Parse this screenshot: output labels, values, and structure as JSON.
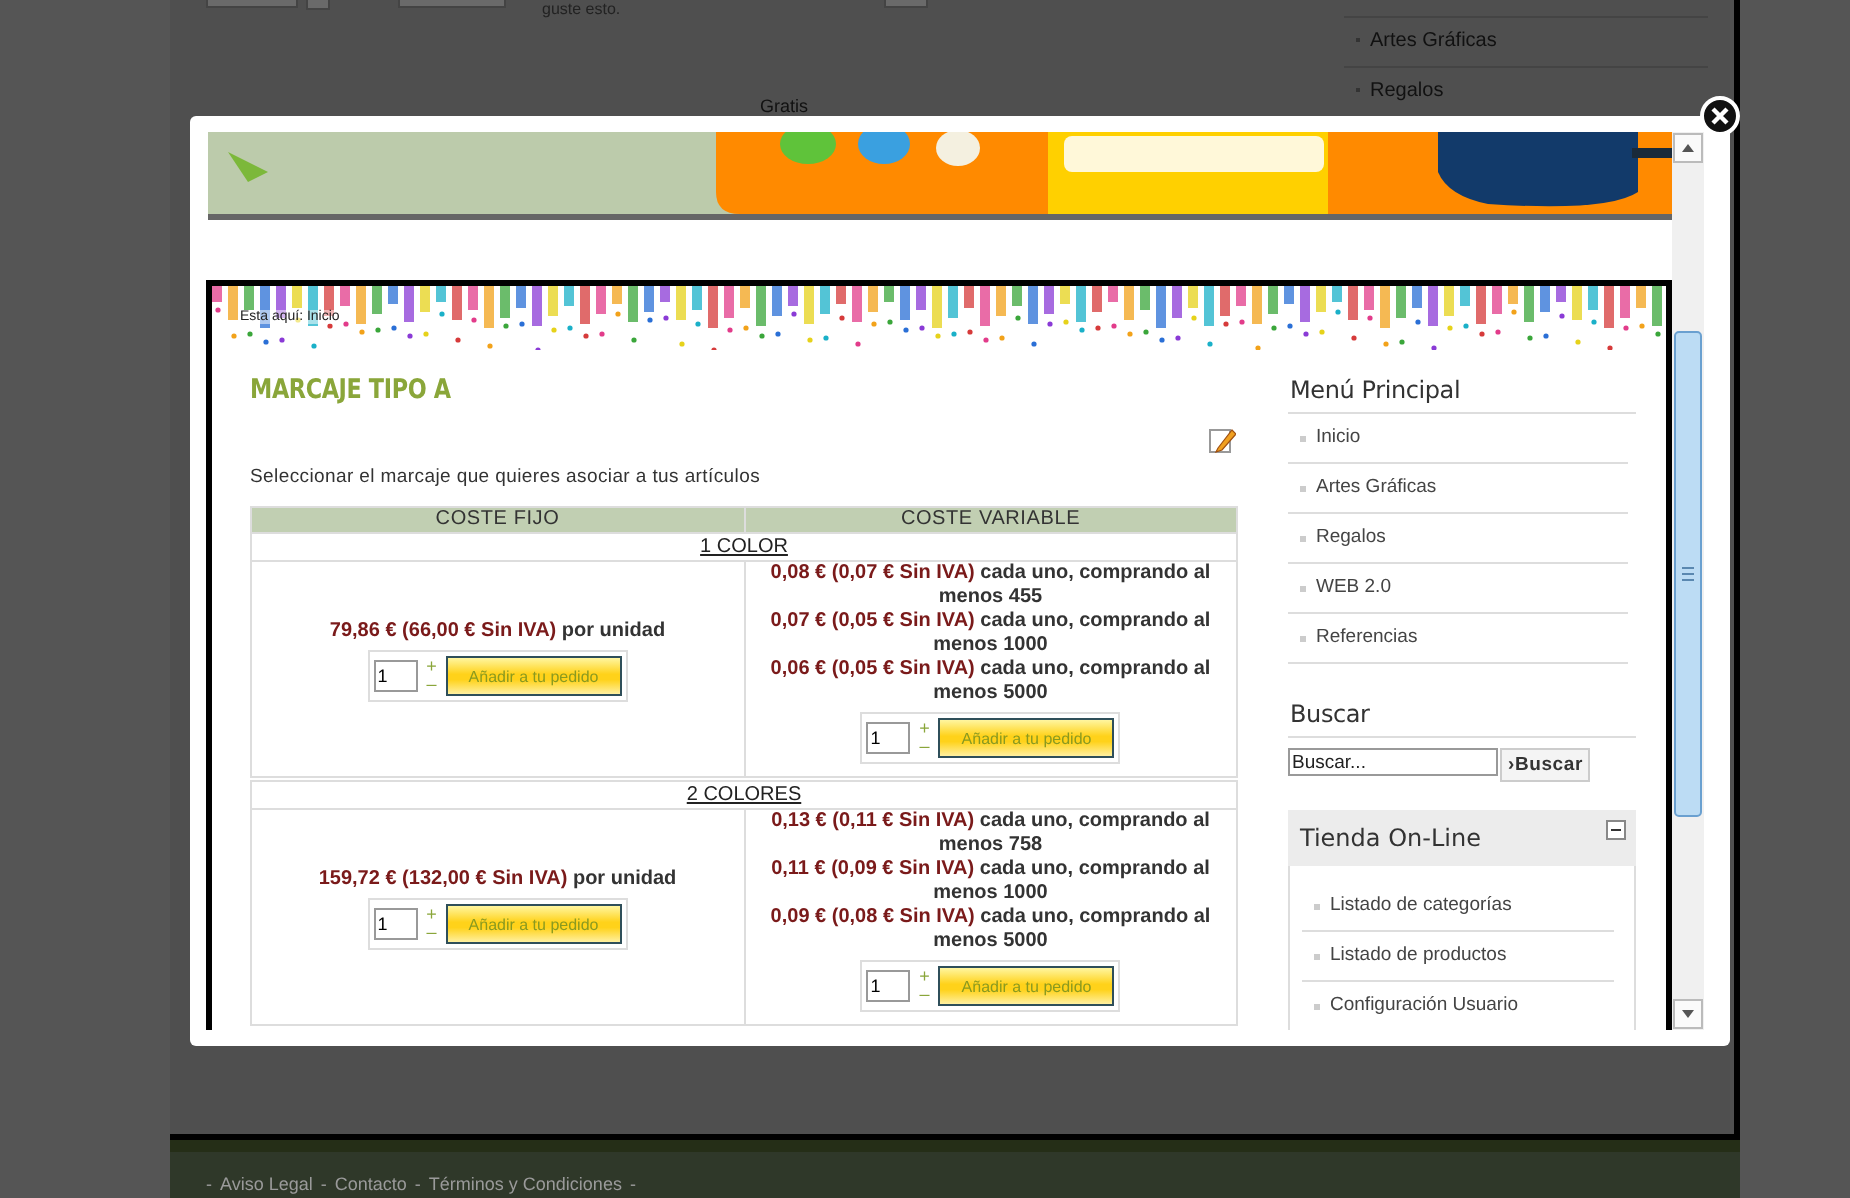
{
  "background_page": {
    "snippet": "guste esto.",
    "caption": "Gratis",
    "sidebar_items": [
      "Artes Gráficas",
      "Regalos"
    ],
    "footer": {
      "separator": "-",
      "links": [
        "Aviso Legal",
        "Contacto",
        "Términos y Condiciones"
      ]
    }
  },
  "lightbox": {
    "breadcrumb": "Esta aquí: Inicio",
    "title": "MARCAJE TIPO A",
    "intro": "Seleccionar el marcaje que quieres asociar a tus artículos",
    "table": {
      "columns": [
        "COSTE FIJO",
        "COSTE VARIABLE"
      ],
      "groups": [
        {
          "name": "1 COLOR",
          "fixed": {
            "price": "79,86 € (66,00 € Sin IVA)",
            "unit": "por unidad",
            "quantity": "1",
            "plus": "+",
            "minus": "–",
            "button": "Añadir a tu pedido"
          },
          "variable": {
            "tiers": [
              {
                "price": "0,08 € (0,07 € Sin IVA)",
                "condition": "cada uno, comprando al menos 455"
              },
              {
                "price": "0,07 € (0,05 € Sin IVA)",
                "condition": "cada uno, comprando al menos 1000"
              },
              {
                "price": "0,06 € (0,05 € Sin IVA)",
                "condition": "cada uno, comprando al menos 5000"
              }
            ],
            "quantity": "1",
            "plus": "+",
            "minus": "–",
            "button": "Añadir a tu pedido"
          }
        },
        {
          "name": "2 COLORES",
          "fixed": {
            "price": "159,72 € (132,00 € Sin IVA)",
            "unit": "por unidad",
            "quantity": "1",
            "plus": "+",
            "minus": "–",
            "button": "Añadir a tu pedido"
          },
          "variable": {
            "tiers": [
              {
                "price": "0,13 € (0,11 € Sin IVA)",
                "condition": "cada uno, comprando al menos 758"
              },
              {
                "price": "0,11 € (0,09 € Sin IVA)",
                "condition": "cada uno, comprando al menos 1000"
              },
              {
                "price": "0,09 € (0,08 € Sin IVA)",
                "condition": "cada uno, comprando al menos 5000"
              }
            ],
            "quantity": "1",
            "plus": "+",
            "minus": "–",
            "button": "Añadir a tu pedido"
          }
        }
      ]
    },
    "sidebar": {
      "menu_title": "Menú Principal",
      "menu_items": [
        "Inicio",
        "Artes Gráficas",
        "Regalos",
        "WEB 2.0",
        "Referencias"
      ],
      "search_title": "Buscar",
      "search_value": "Buscar...",
      "search_button": "›Buscar",
      "shop": {
        "title": "Tienda On-Line",
        "expanded": true,
        "items": [
          "Listado de categorías",
          "Listado de productos",
          "Configuración Usuario"
        ]
      }
    }
  }
}
